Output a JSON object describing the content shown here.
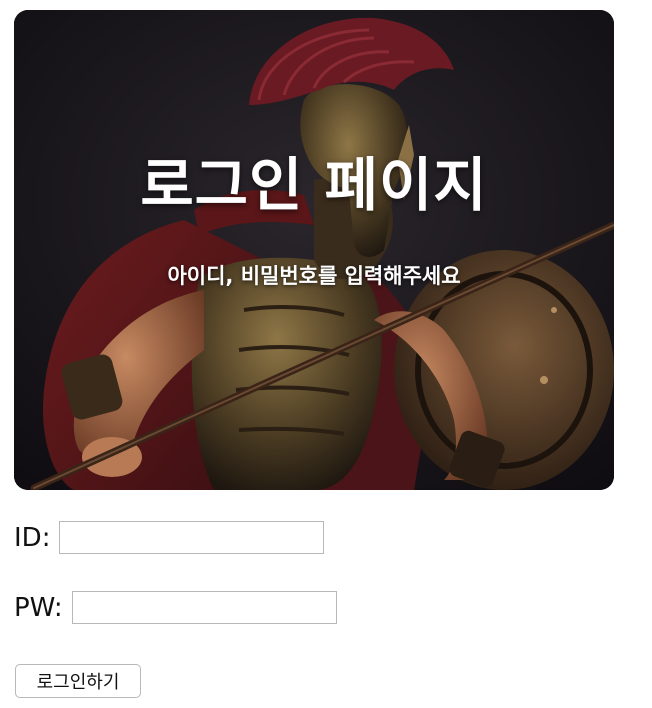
{
  "hero": {
    "title": "로그인 페이지",
    "subtitle": "아이디, 비밀번호를 입력해주세요",
    "image": "spartan-warrior-photo"
  },
  "form": {
    "id_label": "ID:",
    "id_value": "",
    "pw_label": "PW:",
    "pw_value": "",
    "submit_label": "로그인하기"
  }
}
